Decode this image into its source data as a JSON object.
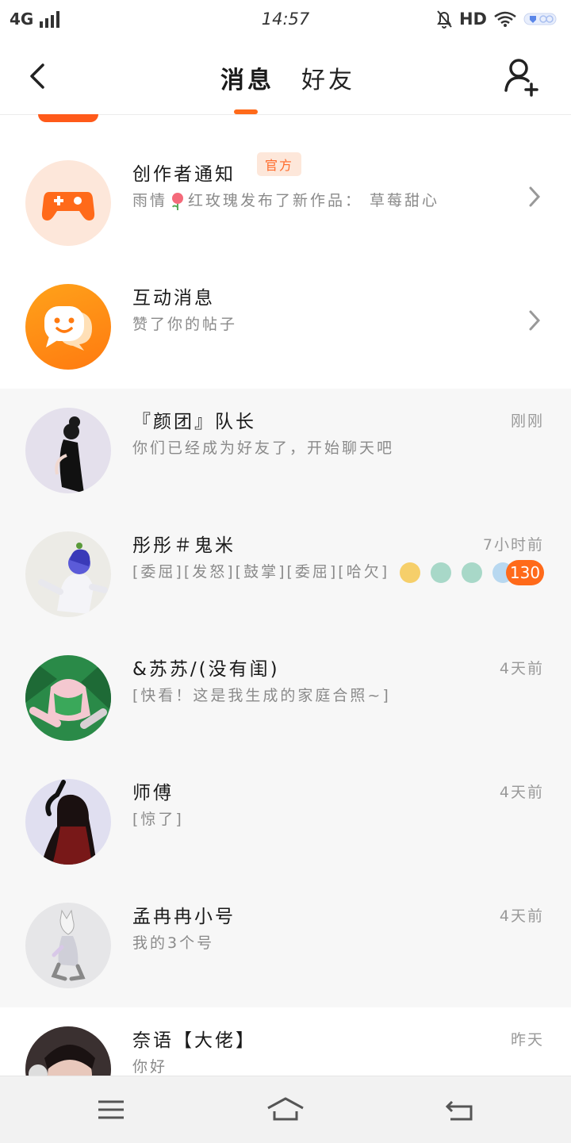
{
  "status_bar": {
    "network": "4G",
    "time": "14:57",
    "hd": "HD"
  },
  "header": {
    "tabs": [
      {
        "label": "消息",
        "active": true
      },
      {
        "label": "好友",
        "active": false
      }
    ],
    "accent_color": "#ff6a1a"
  },
  "system_items": [
    {
      "title": "创作者通知",
      "badge": "官方",
      "subtitle_prefix": "雨情",
      "subtitle_suffix": "红玫瑰发布了新作品：  草莓甜心",
      "icon": "gamepad-icon"
    },
    {
      "title": "互动消息",
      "subtitle": "赞了你的帖子",
      "icon": "chat-bubble-icon"
    }
  ],
  "chats": [
    {
      "name": "『颜团』队长",
      "preview": "你们已经成为好友了，开始聊天吧",
      "time": "刚刚"
    },
    {
      "name": "彤彤＃鬼米",
      "preview": "[委屈][发怒][鼓掌][委屈][哈欠]",
      "time": "7小时前",
      "unread": "130"
    },
    {
      "name": "&苏苏/(没有闺)",
      "preview": "[快看！这是我生成的家庭合照~]",
      "time": "4天前"
    },
    {
      "name": "师傅",
      "preview": "[惊了]",
      "time": "4天前"
    },
    {
      "name": "孟冉冉小号",
      "preview": "我的3个号",
      "time": "4天前"
    },
    {
      "name": "奈语【大佬】",
      "preview": "你好",
      "time": "昨天"
    }
  ]
}
